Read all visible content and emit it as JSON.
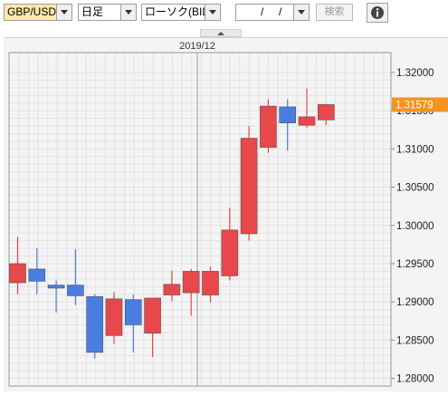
{
  "toolbar": {
    "symbol": "GBP/USD",
    "timeframe": "日足",
    "chart_type": "ローソク(BID)",
    "date_sep1": "/",
    "date_sep2": "/",
    "search_label": "検索",
    "info_icon": "info-icon"
  },
  "chart": {
    "period_label": "2019/12",
    "current_price": "1.31579",
    "colors": {
      "up": "#e8474b",
      "down": "#4a7de0",
      "current": "#f7931e"
    },
    "ylabels": [
      "1.32000",
      "1.31500",
      "1.31000",
      "1.30500",
      "1.30000",
      "1.29500",
      "1.29000",
      "1.28500",
      "1.28000"
    ]
  },
  "chart_data": {
    "type": "candlestick",
    "x_label": "2019/12",
    "ylim": [
      1.279,
      1.3226
    ],
    "last": 1.31579,
    "candles": [
      {
        "o": 1.2925,
        "h": 1.2985,
        "l": 1.291,
        "c": 1.295
      },
      {
        "o": 1.2943,
        "h": 1.297,
        "l": 1.291,
        "c": 1.2927
      },
      {
        "o": 1.2922,
        "h": 1.2928,
        "l": 1.2886,
        "c": 1.2918
      },
      {
        "o": 1.2922,
        "h": 1.2969,
        "l": 1.2896,
        "c": 1.2908
      },
      {
        "o": 1.2907,
        "h": 1.291,
        "l": 1.2826,
        "c": 1.2834
      },
      {
        "o": 1.2856,
        "h": 1.2913,
        "l": 1.2845,
        "c": 1.2904
      },
      {
        "o": 1.2903,
        "h": 1.291,
        "l": 1.2834,
        "c": 1.287
      },
      {
        "o": 1.2859,
        "h": 1.2905,
        "l": 1.2828,
        "c": 1.2905
      },
      {
        "o": 1.2909,
        "h": 1.2941,
        "l": 1.2901,
        "c": 1.2923
      },
      {
        "o": 1.2912,
        "h": 1.2943,
        "l": 1.2882,
        "c": 1.294
      },
      {
        "o": 1.2909,
        "h": 1.2946,
        "l": 1.2899,
        "c": 1.294
      },
      {
        "o": 1.2934,
        "h": 1.3023,
        "l": 1.2928,
        "c": 1.2994
      },
      {
        "o": 1.2989,
        "h": 1.313,
        "l": 1.298,
        "c": 1.3114
      },
      {
        "o": 1.3102,
        "h": 1.3165,
        "l": 1.3095,
        "c": 1.3156
      },
      {
        "o": 1.3155,
        "h": 1.3165,
        "l": 1.3098,
        "c": 1.3134
      },
      {
        "o": 1.3131,
        "h": 1.3179,
        "l": 1.3128,
        "c": 1.3142
      },
      {
        "o": 1.3138,
        "h": 1.3159,
        "l": 1.3131,
        "c": 1.3158
      }
    ]
  }
}
